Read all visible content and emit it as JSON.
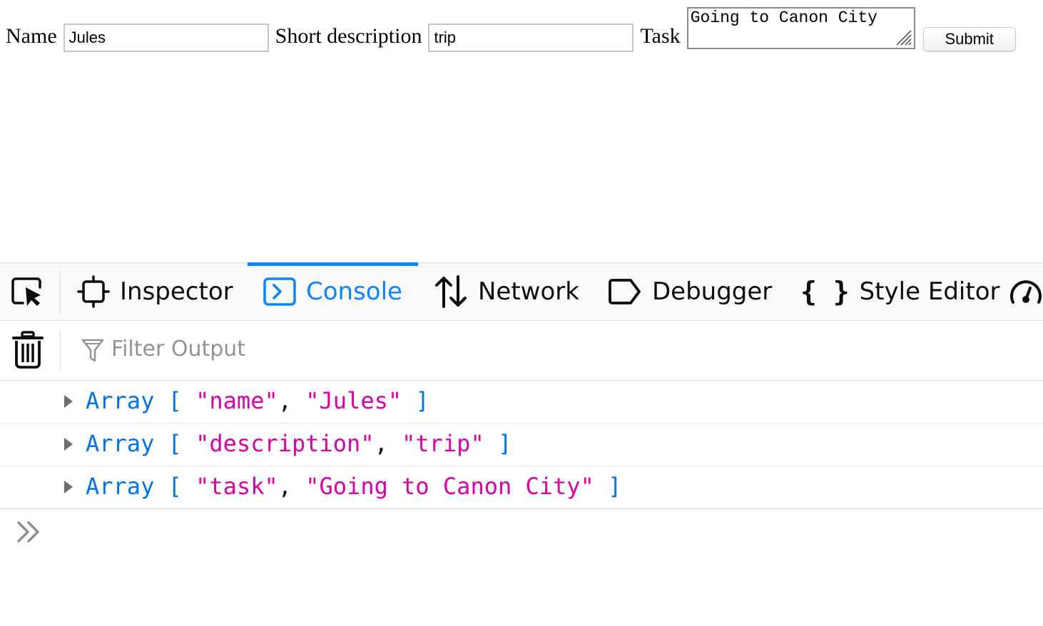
{
  "form": {
    "name_label": "Name",
    "name_value": "Jules",
    "description_label": "Short description",
    "description_value": "trip",
    "task_label": "Task",
    "task_value": "Going to Canon City",
    "submit_label": "Submit"
  },
  "devtools": {
    "tabs": [
      {
        "label": "Inspector",
        "icon": "inspector-icon"
      },
      {
        "label": "Console",
        "icon": "console-icon",
        "active": true
      },
      {
        "label": "Network",
        "icon": "network-icon"
      },
      {
        "label": "Debugger",
        "icon": "debugger-icon"
      },
      {
        "label": "Style Editor",
        "icon": "style-editor-icon"
      }
    ],
    "filter_placeholder": "Filter Output",
    "accent_color": "#0a84ff",
    "messages": [
      {
        "type": "Array",
        "items": [
          "\"name\"",
          "\"Jules\""
        ]
      },
      {
        "type": "Array",
        "items": [
          "\"description\"",
          "\"trip\""
        ]
      },
      {
        "type": "Array",
        "items": [
          "\"task\"",
          "\"Going to Canon City\""
        ]
      }
    ]
  }
}
